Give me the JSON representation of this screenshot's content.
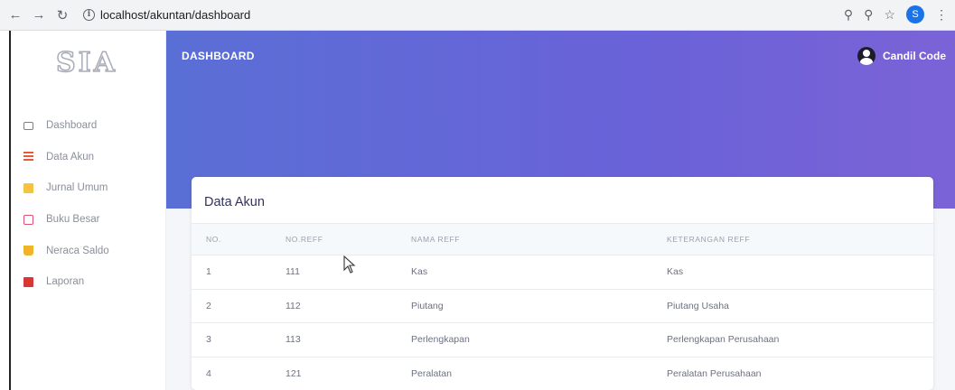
{
  "browser": {
    "url": "localhost/akuntan/dashboard",
    "profile_initial": "S"
  },
  "sidebar": {
    "logo": "SIA",
    "items": [
      {
        "label": "Dashboard",
        "icon": "monitor-icon"
      },
      {
        "label": "Data Akun",
        "icon": "list-icon"
      },
      {
        "label": "Jurnal Umum",
        "icon": "journal-icon"
      },
      {
        "label": "Buku Besar",
        "icon": "ledger-icon"
      },
      {
        "label": "Neraca Saldo",
        "icon": "balance-icon"
      },
      {
        "label": "Laporan",
        "icon": "report-icon"
      }
    ]
  },
  "header": {
    "title": "DASHBOARD",
    "user_name": "Candil Code"
  },
  "card": {
    "title": "Data Akun",
    "columns": [
      "NO.",
      "NO.REFF",
      "NAMA REFF",
      "KETERANGAN REFF"
    ],
    "rows": [
      {
        "no": "1",
        "reff": "111",
        "nama": "Kas",
        "keterangan": "Kas"
      },
      {
        "no": "2",
        "reff": "112",
        "nama": "Piutang",
        "keterangan": "Piutang Usaha"
      },
      {
        "no": "3",
        "reff": "113",
        "nama": "Perlengkapan",
        "keterangan": "Perlengkapan Perusahaan"
      },
      {
        "no": "4",
        "reff": "121",
        "nama": "Peralatan",
        "keterangan": "Peralatan Perusahaan"
      }
    ]
  },
  "colors": {
    "header_start": "#5a6fd6",
    "header_end": "#7b63d6",
    "card_title": "#32325d"
  }
}
